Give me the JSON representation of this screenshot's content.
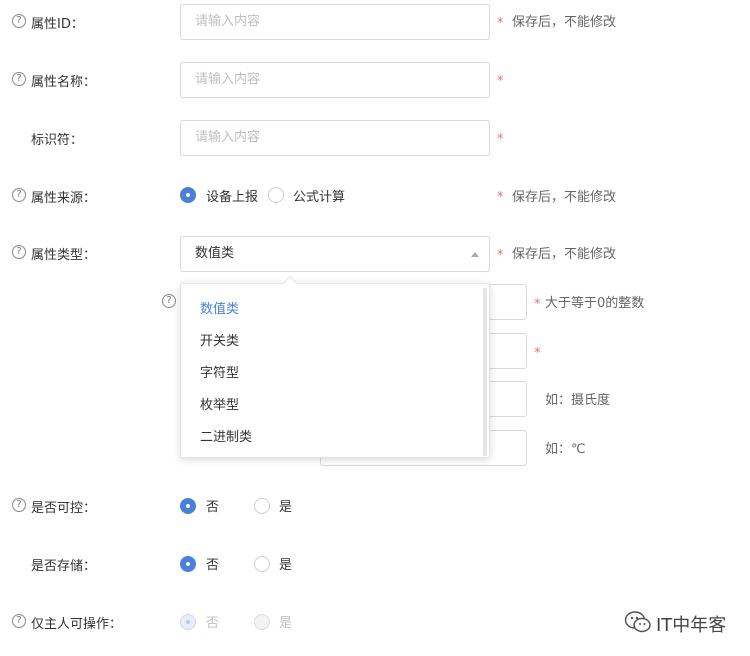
{
  "form": {
    "placeholder": "请输入内容",
    "required_mark": "*",
    "help_glyph": "?",
    "fields": {
      "attr_id": {
        "label": "属性ID：",
        "hint": "保存后，不能修改"
      },
      "attr_name": {
        "label": "属性名称："
      },
      "identifier": {
        "label": "标识符："
      },
      "attr_source": {
        "label": "属性来源：",
        "options": [
          "设备上报",
          "公式计算"
        ],
        "selected": "设备上报",
        "hint": "保存后，不能修改"
      },
      "attr_type": {
        "label": "属性类型：",
        "value": "数值类",
        "hint": "保存后，不能修改",
        "dropdown_options": [
          "数值类",
          "开关类",
          "字符型",
          "枚举型",
          "二进制类"
        ],
        "dropdown_selected": "数值类"
      },
      "decimals": {
        "hint": "大于等于0的整数"
      },
      "unit_name": {
        "hint": "如：摄氏度"
      },
      "unit_symbol": {
        "hint": "如：℃"
      },
      "controllable": {
        "label": "是否可控：",
        "options": [
          "否",
          "是"
        ],
        "selected": "否"
      },
      "stored": {
        "label": "是否存储：",
        "options": [
          "否",
          "是"
        ],
        "selected": "否"
      },
      "owner_only": {
        "label": "仅主人可操作：",
        "options": [
          "否",
          "是"
        ],
        "selected": "否",
        "disabled": true
      }
    }
  },
  "watermark": {
    "text": "IT中年客",
    "icon": "wechat-icon"
  },
  "colors": {
    "accent": "#4a80d8",
    "required": "#f56c6c",
    "border": "#d9d9d9"
  }
}
